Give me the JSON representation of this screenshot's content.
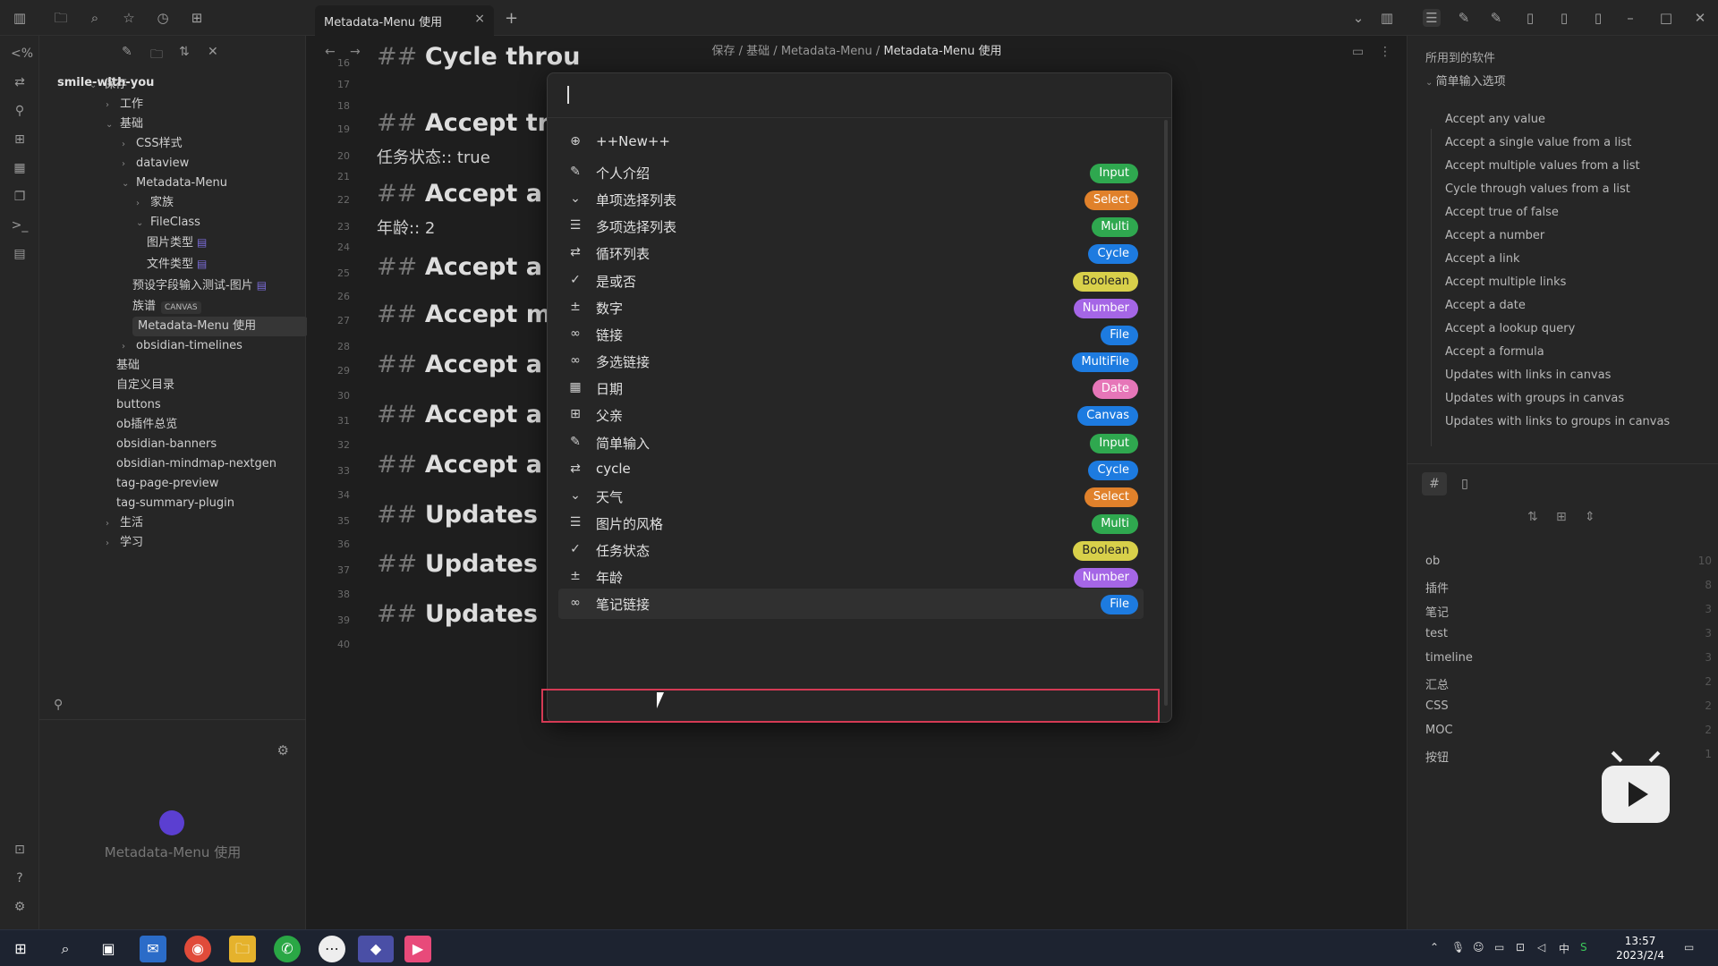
{
  "window": {
    "tab_title": "Metadata-Menu 使用",
    "tab_close": "×",
    "new_tab": "+"
  },
  "breadcrumb": {
    "parts": [
      "保存",
      "基础",
      "Metadata-Menu"
    ],
    "current": "Metadata-Menu 使用",
    "sep": "/"
  },
  "vault": "smile-with-you",
  "tree": [
    {
      "label": "保存",
      "type": "folder-open"
    },
    {
      "label": "工作",
      "type": "folder"
    },
    {
      "label": "基础",
      "type": "folder-open"
    },
    {
      "label": "CSS样式",
      "type": "folder"
    },
    {
      "label": "dataview",
      "type": "folder"
    },
    {
      "label": "Metadata-Menu",
      "type": "folder-open"
    },
    {
      "label": "家族",
      "type": "folder"
    },
    {
      "label": "FileClass",
      "type": "folder-open"
    },
    {
      "label": "图片类型",
      "type": "file"
    },
    {
      "label": "文件类型",
      "type": "file"
    },
    {
      "label": "预设字段输入测试-图片",
      "type": "file"
    },
    {
      "label": "族谱",
      "type": "file",
      "badge": "CANVAS"
    },
    {
      "label": "Metadata-Menu 使用",
      "type": "file"
    },
    {
      "label": "obsidian-timelines",
      "type": "folder"
    },
    {
      "label": "基础",
      "type": "file"
    },
    {
      "label": "自定义目录",
      "type": "file"
    },
    {
      "label": "buttons",
      "type": "file"
    },
    {
      "label": "ob插件总览",
      "type": "file"
    },
    {
      "label": "obsidian-banners",
      "type": "file"
    },
    {
      "label": "obsidian-mindmap-nextgen",
      "type": "file"
    },
    {
      "label": "tag-page-preview",
      "type": "file"
    },
    {
      "label": "tag-summary-plugin",
      "type": "file"
    },
    {
      "label": "生活",
      "type": "folder"
    },
    {
      "label": "学习",
      "type": "folder"
    }
  ],
  "graph_label": "Metadata-Menu 使用",
  "editor": {
    "lines": [
      {
        "n": "16",
        "h": "Cycle throu"
      },
      {
        "n": "17"
      },
      {
        "n": "18"
      },
      {
        "n": "19",
        "h": "Accept true"
      },
      {
        "n": "20",
        "p": "任务状态:: true"
      },
      {
        "n": "21"
      },
      {
        "n": "22",
        "h": "Accept a nu"
      },
      {
        "n": "23",
        "p": "年龄:: 2"
      },
      {
        "n": "24"
      },
      {
        "n": "25",
        "h": "Accept a lir"
      },
      {
        "n": "26"
      },
      {
        "n": "27",
        "h": "Accept mul"
      },
      {
        "n": "28"
      },
      {
        "n": "29",
        "h": "Accept a da"
      },
      {
        "n": "30"
      },
      {
        "n": "31",
        "h": "Accept a lo"
      },
      {
        "n": "32"
      },
      {
        "n": "33",
        "h": "Accept a fo"
      },
      {
        "n": "34"
      },
      {
        "n": "35",
        "h": "Updates wi"
      },
      {
        "n": "36"
      },
      {
        "n": "37",
        "h": "Updates wi"
      },
      {
        "n": "38"
      },
      {
        "n": "39",
        "h": "Updates with links to groups in canvas"
      },
      {
        "n": "40"
      }
    ],
    "hash": "##"
  },
  "modal": {
    "new_label": "++New++",
    "items": [
      {
        "label": "个人介绍",
        "type": "Input",
        "icon": "pencil-icon",
        "glyph": "✎",
        "color": "#2fa84f"
      },
      {
        "label": "单项选择列表",
        "type": "Select",
        "icon": "chevron-down-icon",
        "glyph": "⌄",
        "color": "#e0812b"
      },
      {
        "label": "多项选择列表",
        "type": "Multi",
        "icon": "list-icon",
        "glyph": "☰",
        "color": "#2fa84f"
      },
      {
        "label": "循环列表",
        "type": "Cycle",
        "icon": "repeat-icon",
        "glyph": "⇄",
        "color": "#1d7be0"
      },
      {
        "label": "是或否",
        "type": "Boolean",
        "icon": "check-icon",
        "glyph": "✓",
        "color": "#d8d04a"
      },
      {
        "label": "数字",
        "type": "Number",
        "icon": "plus-minus-icon",
        "glyph": "±",
        "color": "#a566e6"
      },
      {
        "label": "链接",
        "type": "File",
        "icon": "link-icon",
        "glyph": "∞",
        "color": "#1d7be0"
      },
      {
        "label": "多选链接",
        "type": "MultiFile",
        "icon": "link-icon",
        "glyph": "∞",
        "color": "#1d7be0"
      },
      {
        "label": "日期",
        "type": "Date",
        "icon": "calendar-icon",
        "glyph": "▦",
        "color": "#e676b8"
      },
      {
        "label": "父亲",
        "type": "Canvas",
        "icon": "grid-icon",
        "glyph": "⊞",
        "color": "#1d7be0"
      },
      {
        "label": "简单输入",
        "type": "Input",
        "icon": "pencil-icon",
        "glyph": "✎",
        "color": "#2fa84f"
      },
      {
        "label": "cycle",
        "type": "Cycle",
        "icon": "repeat-icon",
        "glyph": "⇄",
        "color": "#1d7be0"
      },
      {
        "label": "天气",
        "type": "Select",
        "icon": "chevron-down-icon",
        "glyph": "⌄",
        "color": "#e0812b"
      },
      {
        "label": "图片的风格",
        "type": "Multi",
        "icon": "list-icon",
        "glyph": "☰",
        "color": "#2fa84f"
      },
      {
        "label": "任务状态",
        "type": "Boolean",
        "icon": "check-icon",
        "glyph": "✓",
        "color": "#d8d04a"
      },
      {
        "label": "年龄",
        "type": "Number",
        "icon": "plus-minus-icon",
        "glyph": "±",
        "color": "#a566e6"
      },
      {
        "label": "笔记链接",
        "type": "File",
        "icon": "link-icon",
        "glyph": "∞",
        "color": "#1d7be0"
      }
    ]
  },
  "outline": {
    "title": "所用到的软件",
    "group": "简单输入选项",
    "items": [
      "Accept any value",
      "Accept a single value from a list",
      "Accept multiple values from a list",
      "Cycle through values from a list",
      "Accept true of false",
      "Accept a number",
      "Accept a link",
      "Accept multiple links",
      "Accept a date",
      "Accept a lookup query",
      "Accept a formula",
      "Updates with links in canvas",
      "Updates with groups in canvas",
      "Updates with links to groups in canvas"
    ]
  },
  "tags": [
    {
      "name": "ob",
      "count": "10"
    },
    {
      "name": "插件",
      "count": "8"
    },
    {
      "name": "笔记",
      "count": "3"
    },
    {
      "name": "test",
      "count": "3"
    },
    {
      "name": "timeline",
      "count": "3"
    },
    {
      "name": "汇总",
      "count": "2"
    },
    {
      "name": "CSS",
      "count": "2"
    },
    {
      "name": "MOC",
      "count": "2"
    },
    {
      "name": "按钮",
      "count": "1"
    }
  ],
  "taskbar": {
    "time": "13:57",
    "date": "2023/2/4",
    "ime": "中"
  }
}
